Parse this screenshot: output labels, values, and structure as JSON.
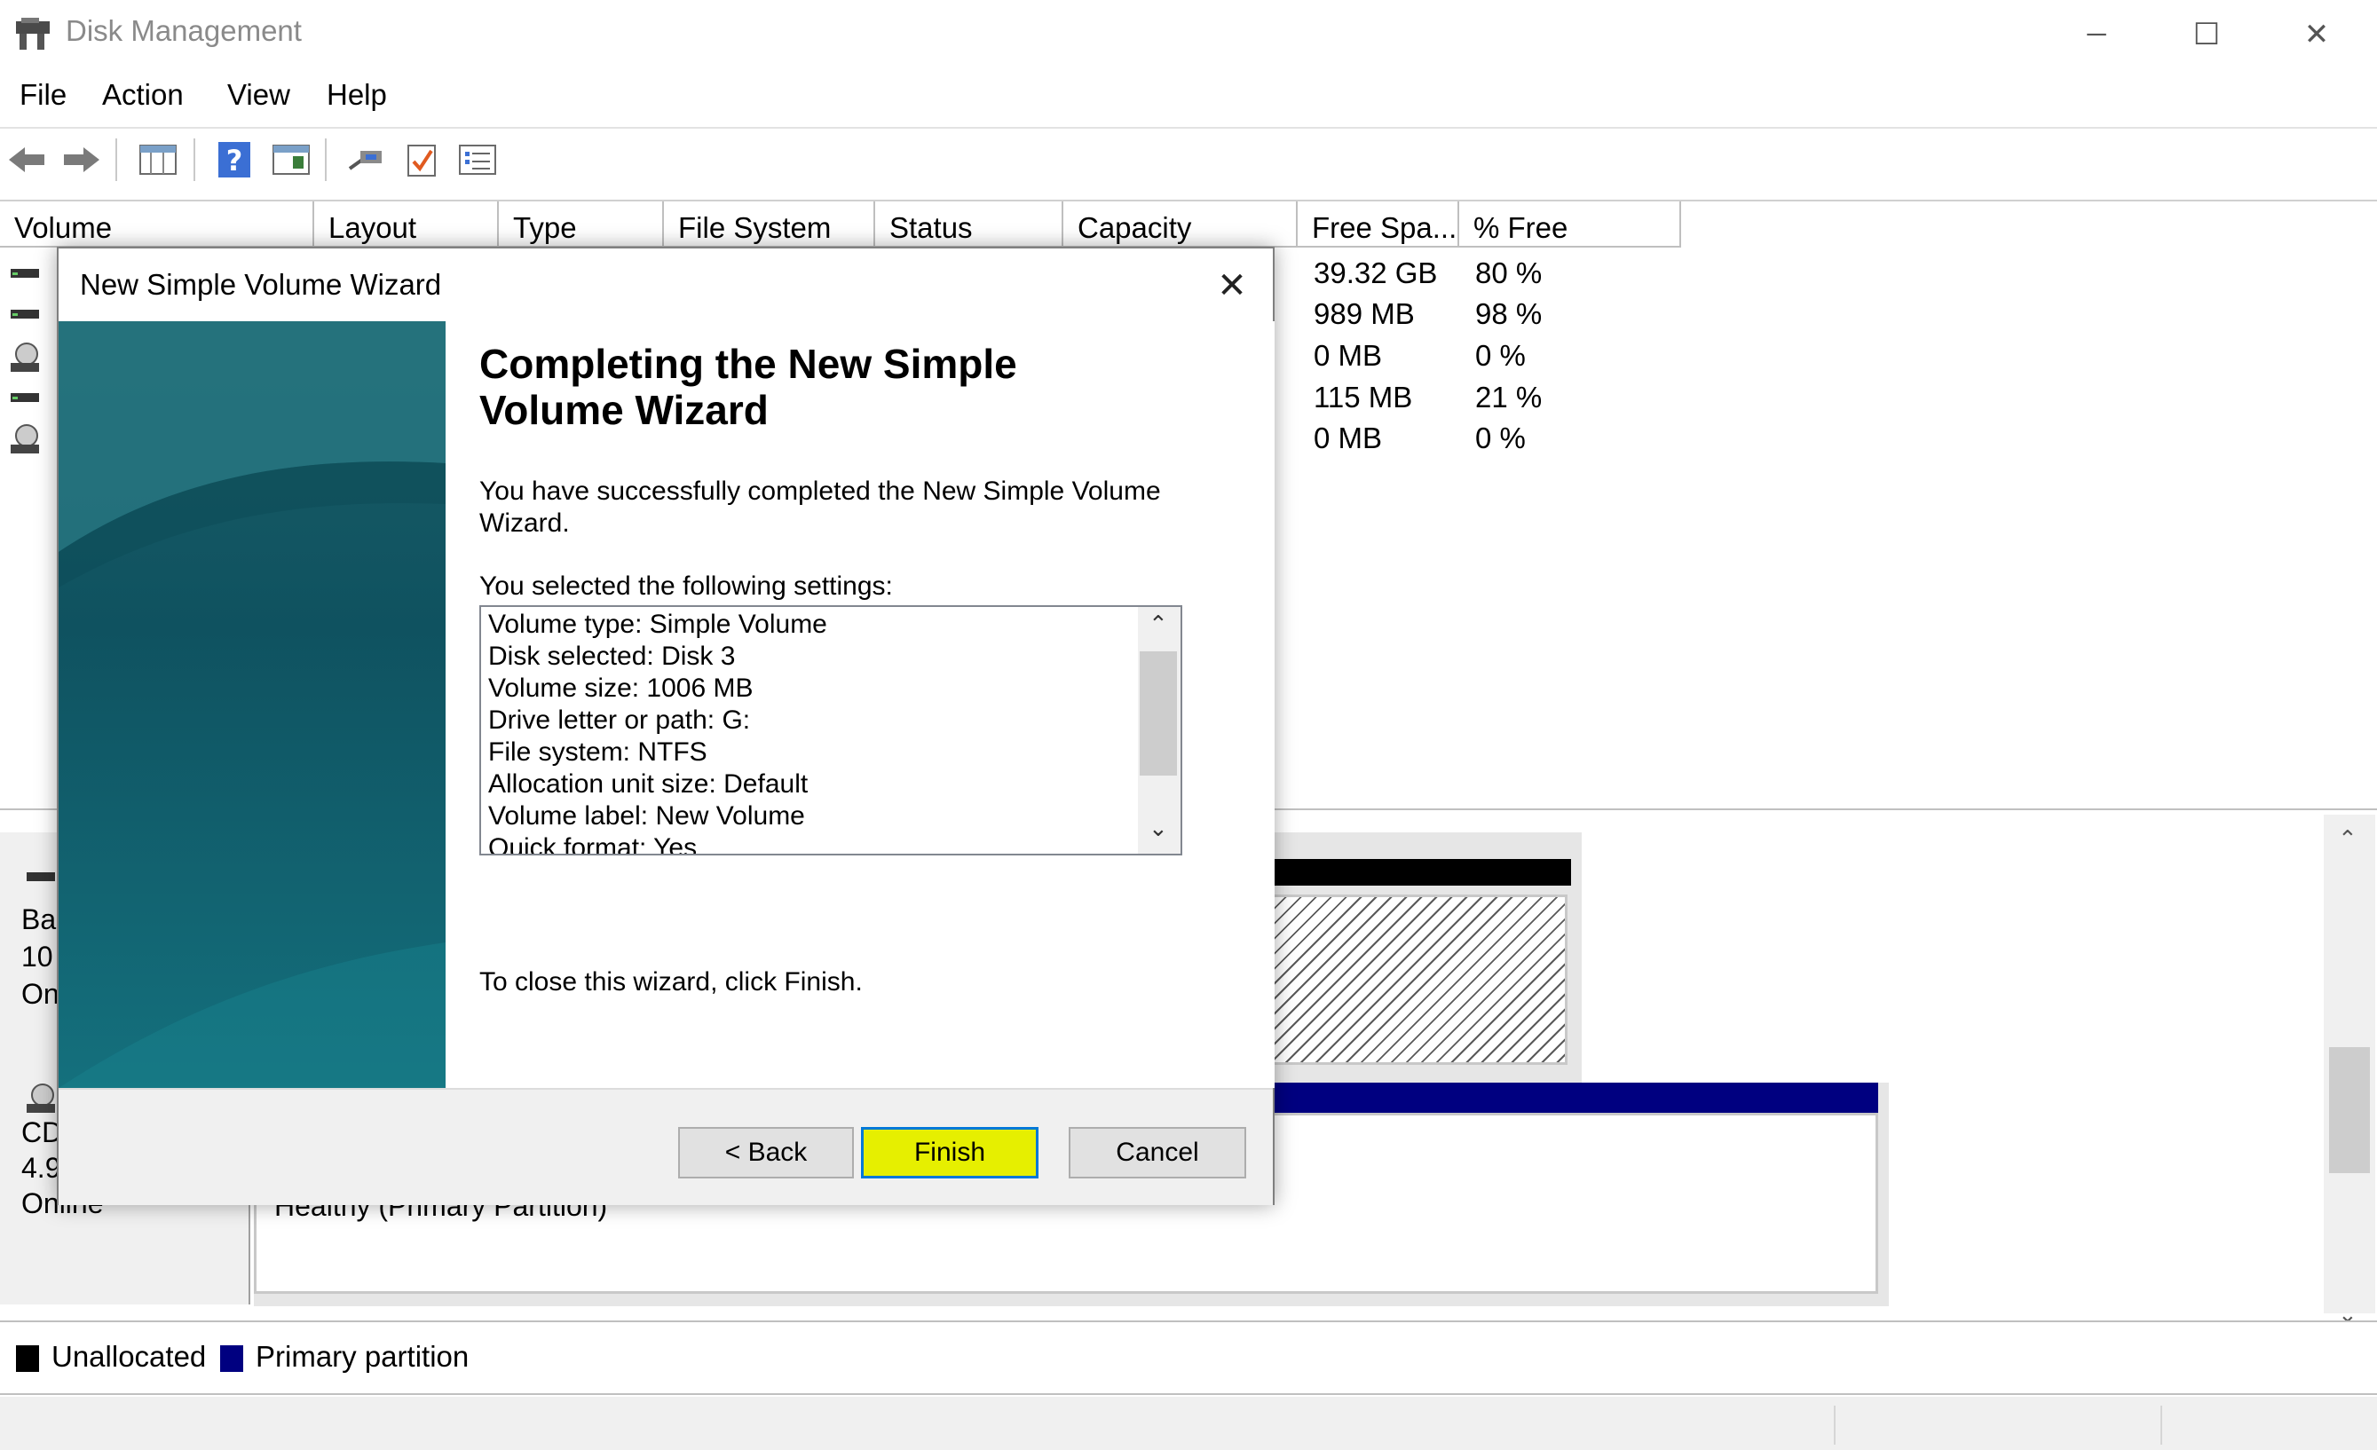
{
  "window": {
    "title": "Disk Management",
    "minimize_glyph": "─",
    "maximize_glyph": "☐",
    "close_glyph": "✕"
  },
  "menu": [
    "File",
    "Action",
    "View",
    "Help"
  ],
  "toolbar": {
    "icons": [
      "back-arrow-icon",
      "forward-arrow-icon",
      "disk-list-icon",
      "help-icon",
      "properties-icon",
      "connect-icon",
      "check-icon",
      "settings-list-icon"
    ]
  },
  "volume_list": {
    "columns": [
      "Volume",
      "Layout",
      "Type",
      "File System",
      "Status",
      "Capacity",
      "Free Spa...",
      "% Free"
    ],
    "rows": [
      {
        "free": "39.32 GB",
        "pct": "80 %"
      },
      {
        "free": "989 MB",
        "pct": "98 %"
      },
      {
        "free": "0 MB",
        "pct": "0 %"
      },
      {
        "free": "115 MB",
        "pct": "21 %"
      },
      {
        "free": "0 MB",
        "pct": "0 %"
      }
    ]
  },
  "graph": {
    "disk1": {
      "line1": "Ba",
      "line2": "10",
      "line3": "On"
    },
    "disk2": {
      "line1": "CD",
      "line2": "4.9",
      "line3": "Online"
    },
    "partition_status": "Healthy (Primary Partition)"
  },
  "legend": [
    {
      "label": "Unallocated",
      "color": "#000000"
    },
    {
      "label": "Primary partition",
      "color": "#000080"
    }
  ],
  "wizard": {
    "title": "New Simple Volume Wizard",
    "close_glyph": "✕",
    "heading": "Completing the New Simple Volume Wizard",
    "success_text": "You have successfully completed the New Simple Volume Wizard.",
    "selected_label": "You selected the following settings:",
    "settings": [
      "Volume type: Simple Volume",
      "Disk selected: Disk 3",
      "Volume size: 1006 MB",
      "Drive letter or path: G:",
      "File system: NTFS",
      "Allocation unit size: Default",
      "Volume label: New Volume",
      "Quick format: Yes"
    ],
    "close_hint": "To close this wizard, click Finish.",
    "back_label": "< Back",
    "finish_label": "Finish",
    "cancel_label": "Cancel",
    "finish_highlight": "#e6ef00"
  }
}
